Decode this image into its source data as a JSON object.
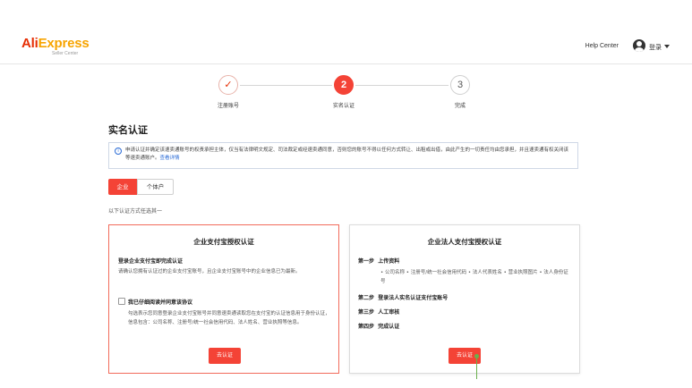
{
  "header": {
    "logo_ali": "Ali",
    "logo_express": "Express",
    "logo_sub": "Seller Center",
    "help_center": "Help Center",
    "login": "登录"
  },
  "stepper": {
    "steps": [
      {
        "number": "✓",
        "label": "注册账号",
        "state": "completed"
      },
      {
        "number": "2",
        "label": "实名认证",
        "state": "active"
      },
      {
        "number": "3",
        "label": "完成",
        "state": "pending"
      }
    ]
  },
  "page_title": "实名认证",
  "notice": {
    "icon": "info-icon",
    "text": "申请认证并确定该速卖通账号的权责承担主体，仅当有法律明文规定、司法裁定或经速卖通同意，否则您的账号不得以任何方式转让、出租或出借，由此产生的一切责任均由您承担，并且速卖通有权关闭该等速卖通账户。",
    "link": "查看详情"
  },
  "tabs": [
    {
      "label": "企业",
      "active": true
    },
    {
      "label": "个体户",
      "active": false
    }
  ],
  "hint": "以下认证方式任选其一",
  "card_left": {
    "title": "企业支付宝授权认证",
    "subtitle": "登录企业支付宝即完成认证",
    "desc": "请确认您拥有认证过的企业支付宝账号，且企业支付宝账号中的企业信息已为最新。",
    "checkbox_label": "我已仔细阅读并同意该协议",
    "checkbox_desc": "勾选表示您同意登录企业支付宝账号并同意速卖通读取您在支付宝的认证信息用于身份认证，信息包含：公司名称、注册号/统一社会信用代码、法人姓名、营业执照等信息。",
    "button": "去认证"
  },
  "card_right": {
    "title": "企业法人支付宝授权认证",
    "steps": [
      {
        "no": "第一步",
        "text": "上传资料"
      },
      {
        "no": "第二步",
        "text": "登录法人实名认证支付宝账号"
      },
      {
        "no": "第三步",
        "text": "人工审核"
      },
      {
        "no": "第四步",
        "text": "完成认证"
      }
    ],
    "step1_desc": "• 公司名称 • 注册号/统一社会信用代码 • 法人代表姓名 • 营业执照图片 • 法人身份证号",
    "button": "去认证"
  },
  "colors": {
    "brand": "#e62e04",
    "accent": "#f44336",
    "link": "#2a6bd6"
  }
}
